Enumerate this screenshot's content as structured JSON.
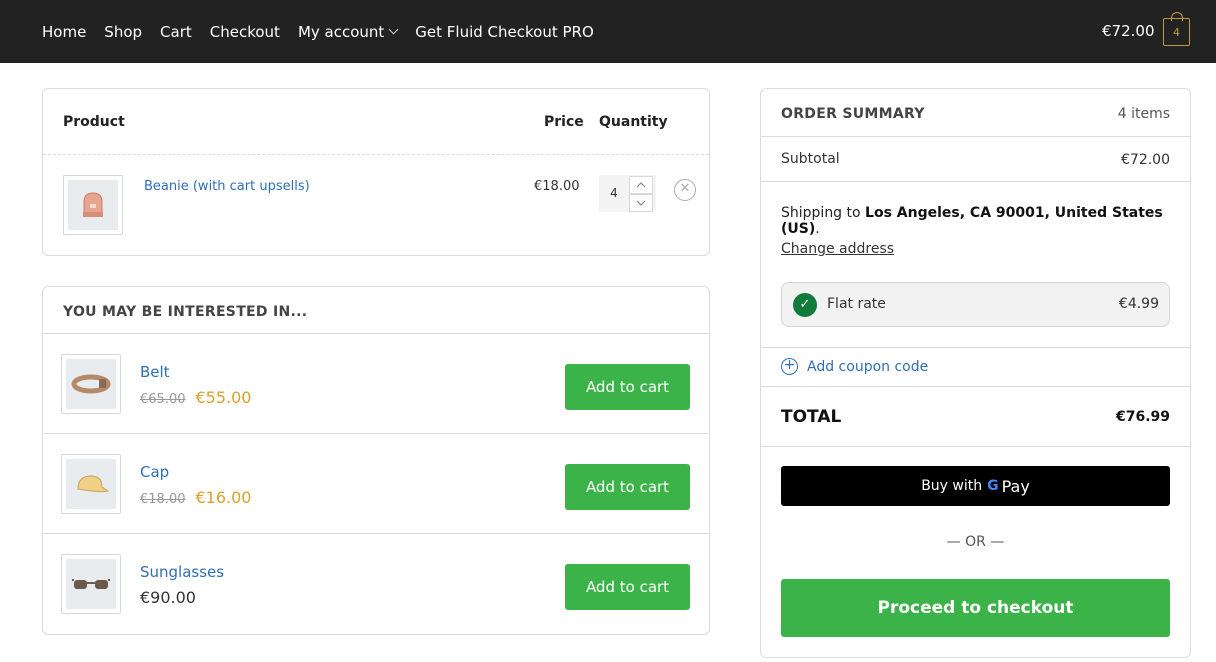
{
  "nav": {
    "items": [
      {
        "label": "Home"
      },
      {
        "label": "Shop"
      },
      {
        "label": "Cart"
      },
      {
        "label": "Checkout"
      },
      {
        "label": "My account",
        "has_dropdown": true
      },
      {
        "label": "Get Fluid Checkout PRO"
      }
    ],
    "cart_total": "€72.00",
    "cart_count": "4"
  },
  "cart": {
    "headers": {
      "product": "Product",
      "price": "Price",
      "quantity": "Quantity"
    },
    "items": [
      {
        "name": "Beanie (with cart upsells)",
        "price": "€18.00",
        "quantity": "4",
        "icon": "beanie-icon"
      }
    ]
  },
  "upsells": {
    "title": "YOU MAY BE INTERESTED IN...",
    "add_label": "Add to cart",
    "items": [
      {
        "name": "Belt",
        "old_price": "€65.00",
        "price": "€55.00",
        "on_sale": true,
        "icon": "belt-icon"
      },
      {
        "name": "Cap",
        "old_price": "€18.00",
        "price": "€16.00",
        "on_sale": true,
        "icon": "cap-icon"
      },
      {
        "name": "Sunglasses",
        "old_price": "",
        "price": "€90.00",
        "on_sale": false,
        "icon": "sunglasses-icon"
      }
    ]
  },
  "summary": {
    "title": "ORDER SUMMARY",
    "item_count": "4 items",
    "subtotal_label": "Subtotal",
    "subtotal_value": "€72.00",
    "shipping_prefix": "Shipping to ",
    "shipping_address": "Los Angeles, CA 90001, United States (US)",
    "shipping_suffix": ".",
    "change_address": "Change address",
    "shipping_method": "Flat rate",
    "shipping_price": "€4.99",
    "coupon_label": "Add coupon code",
    "total_label": "TOTAL",
    "total_value": "€76.99",
    "gpay_label": "Buy with",
    "gpay_brand_g": "G",
    "gpay_brand_pay": "Pay",
    "or_text": "— OR —",
    "checkout_label": "Proceed to checkout"
  },
  "colors": {
    "topbar": "#222222",
    "accent_green": "#3cb349",
    "link_blue": "#2f6fb5",
    "sale_gold": "#d8a12c",
    "check_green": "#127a3b"
  }
}
